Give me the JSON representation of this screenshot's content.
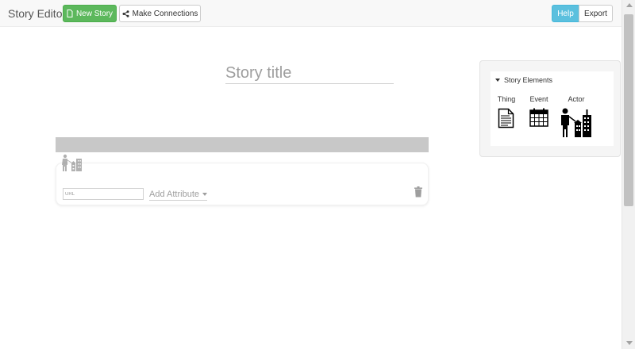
{
  "navbar": {
    "brand": "Story Editor",
    "new_story_label": "New Story",
    "connections_label": "Make Connections",
    "help_label": "Help",
    "export_label": "Export"
  },
  "story": {
    "title_placeholder": "Story title",
    "url_placeholder": "URL",
    "add_attribute_label": "Add Attribute"
  },
  "panel": {
    "heading": "Story Elements",
    "elements": [
      {
        "label": "Thing",
        "icon": "document-icon"
      },
      {
        "label": "Event",
        "icon": "calendar-icon"
      },
      {
        "label": "Actor",
        "icon": "actor-icon"
      }
    ]
  },
  "colors": {
    "new_story": "#5cb85c",
    "help": "#5bc0de",
    "gray_bar": "#c8c8c8"
  }
}
